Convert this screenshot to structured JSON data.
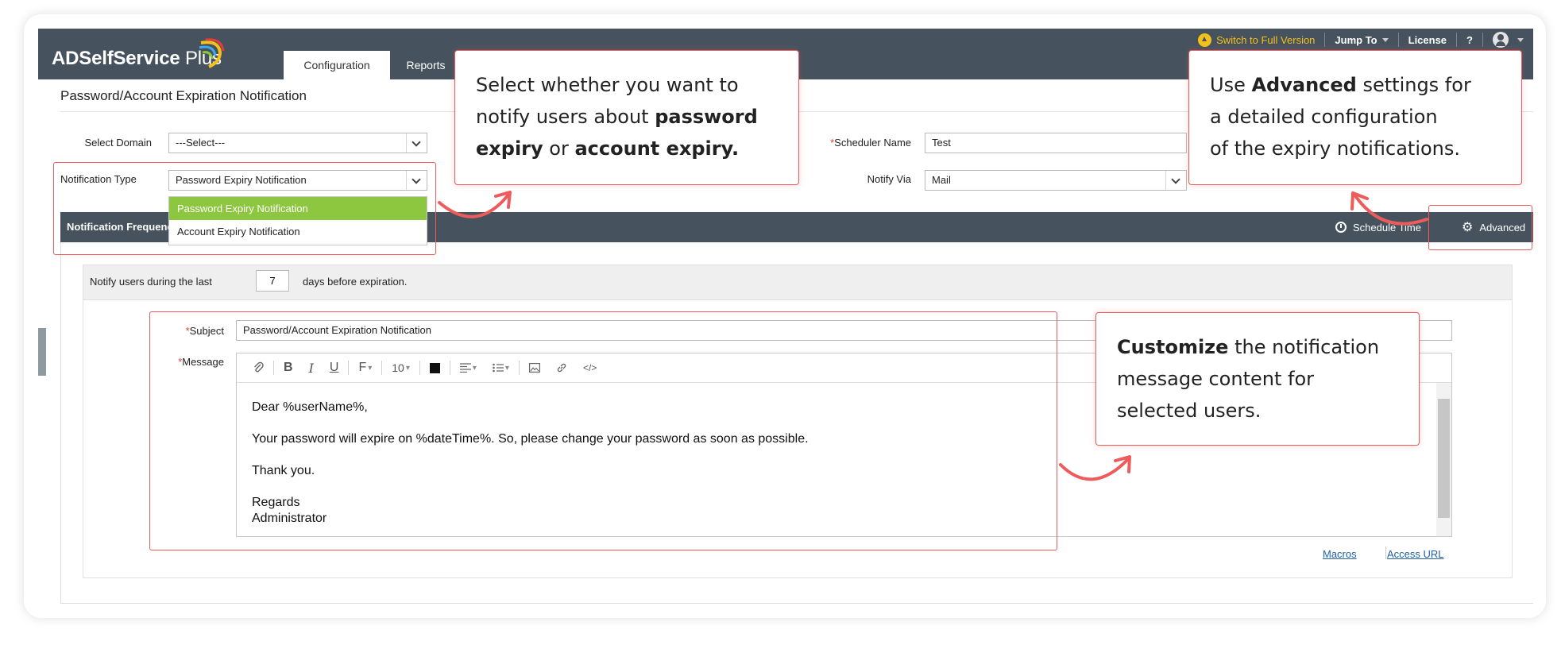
{
  "app": {
    "logo_text": "ADSelfService",
    "logo_plus": "Plus",
    "tabs": [
      "Configuration",
      "Reports"
    ],
    "top_links": {
      "switch": "Switch to Full Version",
      "jump": "Jump To",
      "license": "License",
      "help": "?"
    }
  },
  "page": {
    "title": "Password/Account Expiration Notification"
  },
  "form": {
    "select_domain_label": "Select Domain",
    "select_domain_value": "---Select---",
    "notification_type_label": "Notification Type",
    "notification_type_value": "Password Expiry Notification",
    "notification_type_options": [
      "Password Expiry Notification",
      "Account Expiry Notification"
    ],
    "scheduler_name_label": "Scheduler Name",
    "scheduler_name_value": "Test",
    "notify_via_label": "Notify Via",
    "notify_via_value": "Mail",
    "required_mark": "*"
  },
  "frequency": {
    "title": "Notification Frequency",
    "schedule_time": "Schedule Time",
    "advanced": "Advanced",
    "notify_prefix": "Notify users during the last",
    "days_value": "7",
    "notify_suffix": "days before expiration."
  },
  "message": {
    "subject_label": "Subject",
    "subject_value": "Password/Account Expiration Notification",
    "message_label": "Message",
    "toolbar": {
      "bold": "B",
      "italic": "I",
      "underline": "U",
      "font": "F",
      "font_size": "10"
    },
    "body": {
      "greeting": "Dear %userName%,",
      "line1": "Your password will expire on %dateTime%. So, please change your password as soon as possible.",
      "thanks": "Thank you.",
      "regards": "Regards",
      "signature": "Administrator"
    },
    "macros_link": "Macros",
    "access_url_link": "Access URL"
  },
  "callouts": {
    "type": {
      "l1": "Select whether you want to",
      "l2a": "notify users about ",
      "l2b": "password",
      "l3a": "expiry",
      "l3b": " or ",
      "l3c": "account expiry."
    },
    "advanced": {
      "l1a": "Use ",
      "l1b": "Advanced",
      "l1c": " settings for",
      "l2": "a detailed configuration",
      "l3": "of the expiry notifications."
    },
    "customize": {
      "l1a": "Customize",
      "l1b": " the notification",
      "l2": "message content for",
      "l3": "selected users."
    }
  },
  "colors": {
    "header_bg": "#46535e",
    "accent_red": "#ef5b5b",
    "selected_green": "#8dc63f",
    "link_blue": "#1f5fa8",
    "switch_yellow": "#f4c11c"
  }
}
